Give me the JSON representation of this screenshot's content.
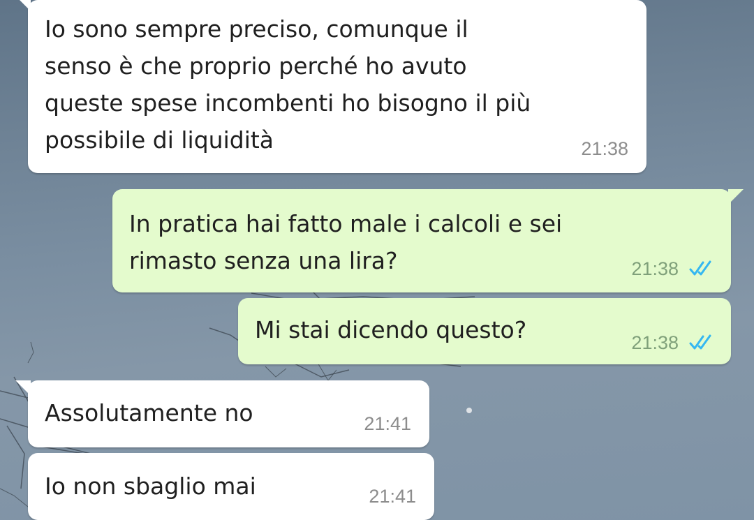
{
  "messages": [
    {
      "direction": "incoming",
      "text": "Io sono sempre preciso, comunque il\nsenso è che proprio perché ho avuto\nqueste spese incombenti ho bisogno il più\npossibile di liquidità",
      "time": "21:38"
    },
    {
      "direction": "outgoing",
      "text": "In pratica hai fatto male i calcoli e sei\nrimasto senza una lira?",
      "time": "21:38",
      "status": "read"
    },
    {
      "direction": "outgoing",
      "text": "Mi stai dicendo questo?",
      "time": "21:38",
      "status": "read"
    },
    {
      "direction": "incoming",
      "text": "Assolutamente no",
      "time": "21:41"
    },
    {
      "direction": "incoming",
      "text": "Io non sbaglio mai",
      "time": "21:41"
    }
  ],
  "colors": {
    "incoming_bubble": "#ffffff",
    "outgoing_bubble": "#e4fbcd",
    "read_ticks": "#34b7f1",
    "text": "#1f1f1f",
    "timestamp": "#8c8c8c"
  },
  "icons": {
    "read_status": "double-check-icon"
  }
}
